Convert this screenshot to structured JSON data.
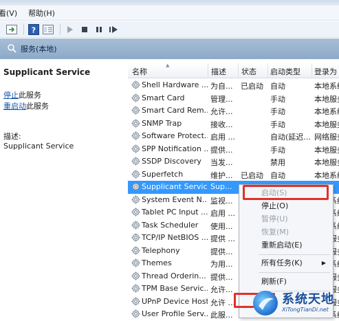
{
  "menubar": {
    "items": [
      "看(V)",
      "帮助(H)"
    ]
  },
  "toolbar": {
    "icons": [
      "console-icon",
      "help-icon",
      "properties-icon",
      "play-icon",
      "stop-icon",
      "pause-icon",
      "restart-icon"
    ]
  },
  "header": {
    "title": "服务(本地)"
  },
  "left_pane": {
    "title": "Supplicant Service",
    "stop_link": "停止",
    "stop_rest": "此服务",
    "restart_link": "重启动",
    "restart_rest": "此服务",
    "desc_label": "描述:",
    "desc_text": "Supplicant Service"
  },
  "columns": {
    "name": "名称",
    "desc": "描述",
    "status": "状态",
    "start": "启动类型",
    "logon": "登录为"
  },
  "services": [
    {
      "name": "Shell Hardware ...",
      "desc": "为自...",
      "status": "已启动",
      "start": "自动",
      "logon": "本地系统"
    },
    {
      "name": "Smart Card",
      "desc": "管理...",
      "status": "",
      "start": "手动",
      "logon": "本地服务"
    },
    {
      "name": "Smart Card Rem...",
      "desc": "允许...",
      "status": "",
      "start": "手动",
      "logon": "本地系统"
    },
    {
      "name": "SNMP Trap",
      "desc": "接收...",
      "status": "",
      "start": "手动",
      "logon": "本地服务"
    },
    {
      "name": "Software Protect...",
      "desc": "启用 ...",
      "status": "",
      "start": "自动(延迟...",
      "logon": "网络服务"
    },
    {
      "name": "SPP Notification ...",
      "desc": "提供...",
      "status": "",
      "start": "手动",
      "logon": "本地服务"
    },
    {
      "name": "SSDP Discovery",
      "desc": "当发...",
      "status": "",
      "start": "禁用",
      "logon": "本地服务"
    },
    {
      "name": "Superfetch",
      "desc": "维护...",
      "status": "已启动",
      "start": "自动",
      "logon": "本地系统"
    },
    {
      "name": "Supplicant Service",
      "desc": "Sup...",
      "status": "",
      "start": "",
      "logon": "本地"
    },
    {
      "name": "System Event N...",
      "desc": "监视...",
      "status": "",
      "start": "",
      "logon": "本地系统"
    },
    {
      "name": "Tablet PC Input ...",
      "desc": "启用 ...",
      "status": "",
      "start": "",
      "logon": "本地系统"
    },
    {
      "name": "Task Scheduler",
      "desc": "使用...",
      "status": "",
      "start": "",
      "logon": "本地系统"
    },
    {
      "name": "TCP/IP NetBIOS ...",
      "desc": "提供 ...",
      "status": "",
      "start": "",
      "logon": "本地服务"
    },
    {
      "name": "Telephony",
      "desc": "提供...",
      "status": "",
      "start": "",
      "logon": "网络服务"
    },
    {
      "name": "Themes",
      "desc": "为用...",
      "status": "",
      "start": "",
      "logon": "本地系统"
    },
    {
      "name": "Thread Orderin...",
      "desc": "提供...",
      "status": "",
      "start": "",
      "logon": "本地服务"
    },
    {
      "name": "TPM Base Servic...",
      "desc": "允许...",
      "status": "",
      "start": "",
      "logon": "本地服务"
    },
    {
      "name": "UPnP Device Host",
      "desc": "允许 ...",
      "status": "",
      "start": "",
      "logon": "本地服务"
    },
    {
      "name": "User Profile Serv...",
      "desc": "此服...",
      "status": "",
      "start": "",
      "logon": "本地系统"
    }
  ],
  "selected_index": 8,
  "context_menu": {
    "start": "启动(S)",
    "stop": "停止(O)",
    "pause": "暂停(U)",
    "resume": "恢复(M)",
    "restart": "重新启动(E)",
    "all_tasks": "所有任务(K)",
    "refresh": "刷新(F)",
    "submenu_arrow": "▶"
  },
  "watermark": {
    "text_cn": "系统天地",
    "text_url": "XiTongTianDi.net"
  },
  "colors": {
    "selection": "#3399ff",
    "highlight_border": "#e0302a",
    "header_band": "#97b3d0"
  }
}
